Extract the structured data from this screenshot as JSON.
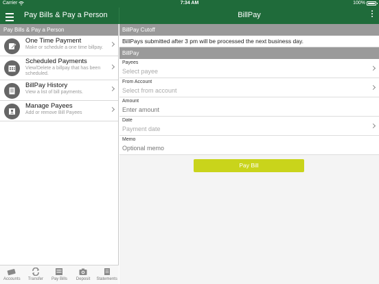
{
  "status_bar": {
    "carrier": "Carrier",
    "time": "7:34 AM",
    "battery": "100%"
  },
  "navbar": {
    "left_title": "Pay Bills & Pay a Person",
    "center_title": "BillPay"
  },
  "sidebar": {
    "header": "Pay Bills & Pay a Person",
    "items": [
      {
        "title": "One Time Payment",
        "desc": "Make or schedule a one time billpay.",
        "icon": "pencil-note-icon"
      },
      {
        "title": "Scheduled Payments",
        "desc": "View/Delete a billpay that has been scheduled.",
        "icon": "calendar-icon"
      },
      {
        "title": "BillPay History",
        "desc": "View a list of bill payments.",
        "icon": "document-list-icon"
      },
      {
        "title": "Manage Payees",
        "desc": "Add or remove Bill Payees",
        "icon": "address-book-icon"
      }
    ]
  },
  "tabbar": {
    "tabs": [
      {
        "label": "Accounts",
        "icon": "accounts-icon"
      },
      {
        "label": "Transfer",
        "icon": "transfer-icon"
      },
      {
        "label": "Pay Bills",
        "icon": "pay-bills-icon"
      },
      {
        "label": "Deposit",
        "icon": "camera-icon"
      },
      {
        "label": "Statements",
        "icon": "statements-icon"
      }
    ]
  },
  "main": {
    "cutoff_header": "BillPay Cutoff",
    "cutoff_text": "BillPays submitted after 3 pm will be processed the next business day.",
    "billpay_header": "BillPay",
    "fields": {
      "payees": {
        "label": "Payees",
        "placeholder": "Select payee"
      },
      "from_account": {
        "label": "From Account",
        "placeholder": "Select from account"
      },
      "amount": {
        "label": "Amount",
        "placeholder": "Enter amount"
      },
      "date": {
        "label": "Date",
        "placeholder": "Payment date"
      },
      "memo": {
        "label": "Memo",
        "placeholder": "Optional memo"
      }
    },
    "pay_button": "Pay Bill"
  },
  "colors": {
    "brand_green": "#1f6b3a",
    "header_gray": "#9a9a9a",
    "pay_button": "#c9d41b"
  }
}
